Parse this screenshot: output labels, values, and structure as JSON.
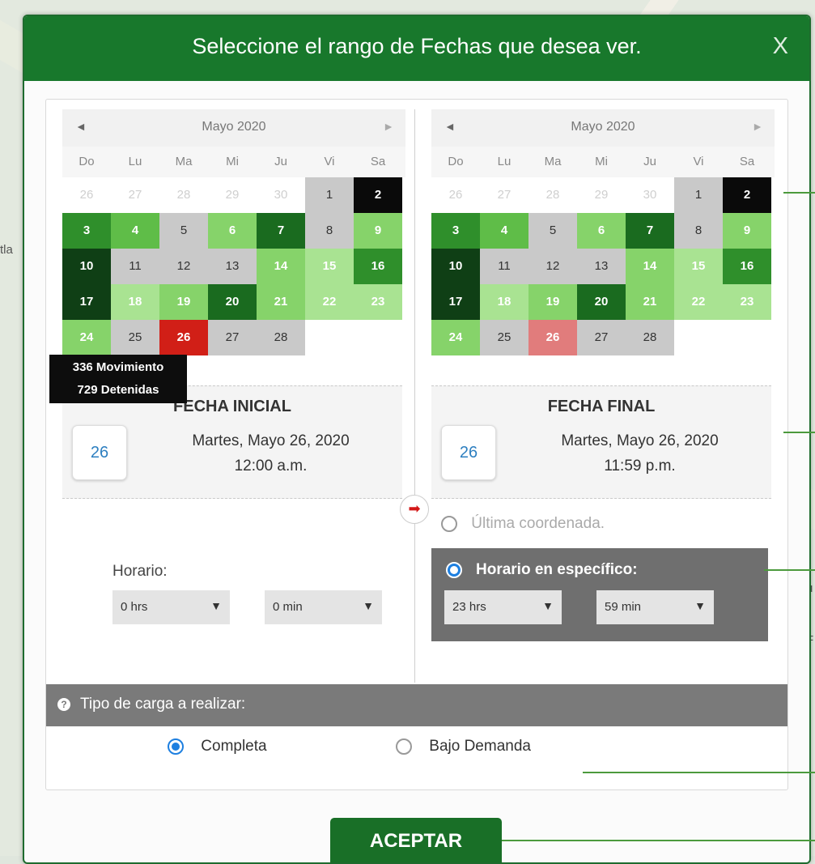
{
  "map": {
    "left_labels": [
      "tla"
    ],
    "right_labels": [
      "u",
      "F",
      "t"
    ]
  },
  "dialog": {
    "title": "Seleccione el rango de Fechas que desea ver.",
    "close_label": "X"
  },
  "calendars": [
    {
      "month_label": "Mayo 2020",
      "prev_icon": "◄",
      "next_icon": "►",
      "weekdays": [
        "Do",
        "Lu",
        "Ma",
        "Mi",
        "Ju",
        "Vi",
        "Sa"
      ],
      "days": [
        {
          "n": "26",
          "c": "dim"
        },
        {
          "n": "27",
          "c": "dim"
        },
        {
          "n": "28",
          "c": "dim"
        },
        {
          "n": "29",
          "c": "dim"
        },
        {
          "n": "30",
          "c": "dim"
        },
        {
          "n": "1",
          "c": "gray"
        },
        {
          "n": "2",
          "c": "black"
        },
        {
          "n": "3",
          "c": "d3"
        },
        {
          "n": "4",
          "c": "m"
        },
        {
          "n": "5",
          "c": "gray"
        },
        {
          "n": "6",
          "c": "l"
        },
        {
          "n": "7",
          "c": "d2"
        },
        {
          "n": "8",
          "c": "gray"
        },
        {
          "n": "9",
          "c": "l"
        },
        {
          "n": "10",
          "c": "d1"
        },
        {
          "n": "11",
          "c": "gray"
        },
        {
          "n": "12",
          "c": "gray"
        },
        {
          "n": "13",
          "c": "gray"
        },
        {
          "n": "14",
          "c": "l"
        },
        {
          "n": "15",
          "c": "xl"
        },
        {
          "n": "16",
          "c": "d3"
        },
        {
          "n": "17",
          "c": "d1"
        },
        {
          "n": "18",
          "c": "xl"
        },
        {
          "n": "19",
          "c": "l"
        },
        {
          "n": "20",
          "c": "d2"
        },
        {
          "n": "21",
          "c": "l"
        },
        {
          "n": "22",
          "c": "xl"
        },
        {
          "n": "23",
          "c": "xl"
        },
        {
          "n": "24",
          "c": "l"
        },
        {
          "n": "25",
          "c": "gray"
        },
        {
          "n": "26",
          "c": "red"
        },
        {
          "n": "27",
          "c": "gray"
        },
        {
          "n": "28",
          "c": "gray"
        },
        {
          "n": "",
          "c": "empty"
        },
        {
          "n": "",
          "c": "empty"
        }
      ]
    },
    {
      "month_label": "Mayo 2020",
      "prev_icon": "◄",
      "next_icon": "►",
      "weekdays": [
        "Do",
        "Lu",
        "Ma",
        "Mi",
        "Ju",
        "Vi",
        "Sa"
      ],
      "days": [
        {
          "n": "26",
          "c": "dim"
        },
        {
          "n": "27",
          "c": "dim"
        },
        {
          "n": "28",
          "c": "dim"
        },
        {
          "n": "29",
          "c": "dim"
        },
        {
          "n": "30",
          "c": "dim"
        },
        {
          "n": "1",
          "c": "gray"
        },
        {
          "n": "2",
          "c": "black"
        },
        {
          "n": "3",
          "c": "d3"
        },
        {
          "n": "4",
          "c": "m"
        },
        {
          "n": "5",
          "c": "gray"
        },
        {
          "n": "6",
          "c": "l"
        },
        {
          "n": "7",
          "c": "d2"
        },
        {
          "n": "8",
          "c": "gray"
        },
        {
          "n": "9",
          "c": "l"
        },
        {
          "n": "10",
          "c": "d1"
        },
        {
          "n": "11",
          "c": "gray"
        },
        {
          "n": "12",
          "c": "gray"
        },
        {
          "n": "13",
          "c": "gray"
        },
        {
          "n": "14",
          "c": "l"
        },
        {
          "n": "15",
          "c": "xl"
        },
        {
          "n": "16",
          "c": "d3"
        },
        {
          "n": "17",
          "c": "d1"
        },
        {
          "n": "18",
          "c": "xl"
        },
        {
          "n": "19",
          "c": "l"
        },
        {
          "n": "20",
          "c": "d2"
        },
        {
          "n": "21",
          "c": "l"
        },
        {
          "n": "22",
          "c": "xl"
        },
        {
          "n": "23",
          "c": "xl"
        },
        {
          "n": "24",
          "c": "l"
        },
        {
          "n": "25",
          "c": "gray"
        },
        {
          "n": "26",
          "c": "pink"
        },
        {
          "n": "27",
          "c": "gray"
        },
        {
          "n": "28",
          "c": "gray"
        },
        {
          "n": "",
          "c": "empty"
        },
        {
          "n": "",
          "c": "empty"
        }
      ]
    }
  ],
  "tooltip": {
    "line1": "336 Movimiento",
    "line2": "729 Detenidas"
  },
  "start": {
    "label": "FECHA INICIAL",
    "day": "26",
    "date": "Martes, Mayo 26, 2020",
    "time": "12:00 a.m."
  },
  "end": {
    "label": "FECHA FINAL",
    "day": "26",
    "date": "Martes, Mayo 26, 2020",
    "time": "11:59 p.m."
  },
  "arrow_icon": "➡",
  "start_time": {
    "label": "Horario:",
    "hours": "0 hrs",
    "minutes": "0 min",
    "caret": "▼"
  },
  "end_options": {
    "last_coord": "Última coordenada.",
    "specific": "Horario en específico:",
    "hours": "23 hrs",
    "minutes": "59 min",
    "caret": "▼"
  },
  "load_type": {
    "title": "Tipo de carga a realizar:",
    "help_icon": "?",
    "options": [
      "Completa",
      "Bajo Demanda"
    ]
  },
  "accept_label": "ACEPTAR"
}
